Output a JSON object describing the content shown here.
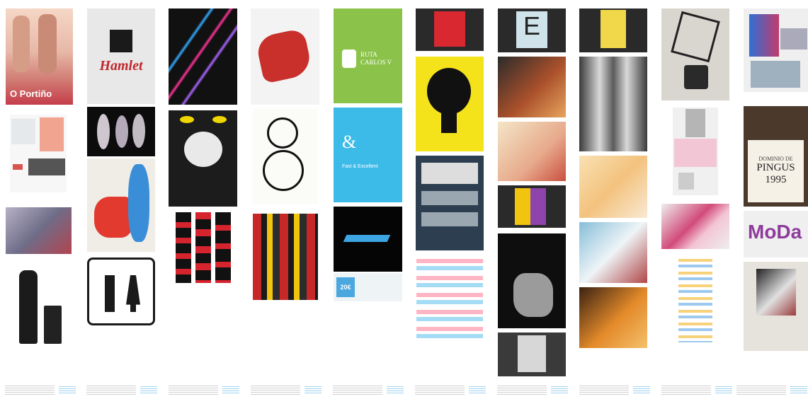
{
  "posters": {
    "hamlet": "Hamlet",
    "portino": "O Portiño",
    "ruta_line1": "RUTA",
    "ruta_line2": "CARLOS V",
    "ampersand": "&",
    "fast_excellent": "Fast & Excellent",
    "e_letter": "E",
    "pingus_line1": "DOMINIO DE",
    "pingus_line2": "PINGUS",
    "pingus_year": "1995",
    "moda": "MoDa",
    "price": "20€"
  },
  "colors": {
    "green": "#8bc34a",
    "cyan": "#3dbbe8",
    "yellow": "#f4e21a",
    "red": "#d32f2f",
    "navy": "#2c3e50"
  }
}
